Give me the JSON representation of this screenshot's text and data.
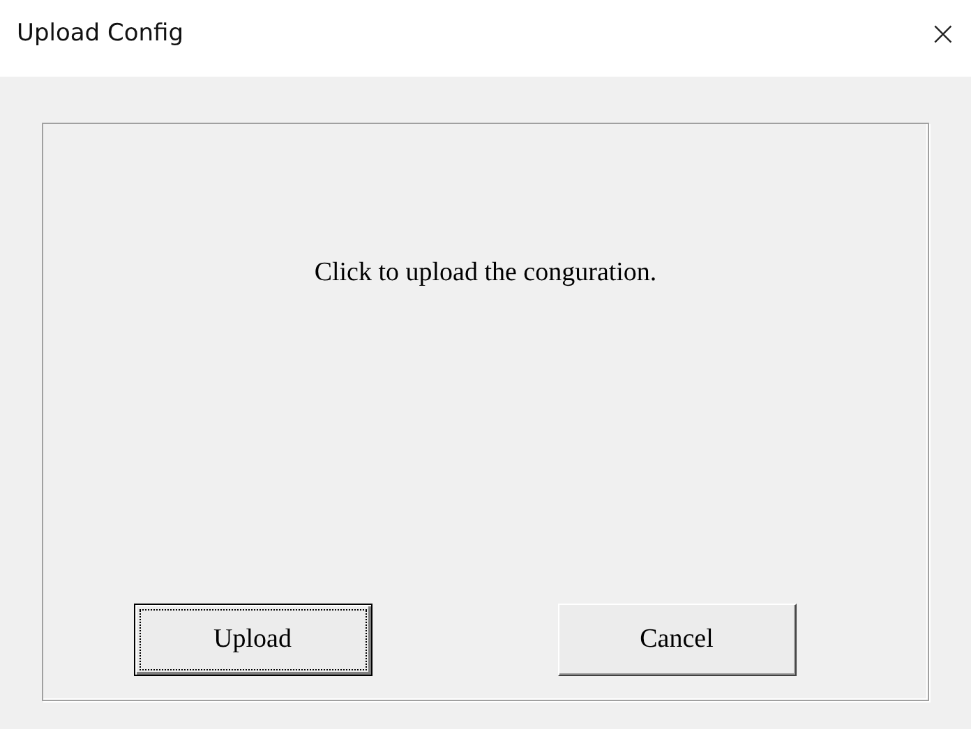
{
  "window": {
    "title": "Upload Config",
    "close": "×"
  },
  "message": "Click to upload the conguration.",
  "buttons": [
    {
      "label": "Upload",
      "focused": true
    },
    {
      "label": "Cancel",
      "focused": false
    }
  ]
}
